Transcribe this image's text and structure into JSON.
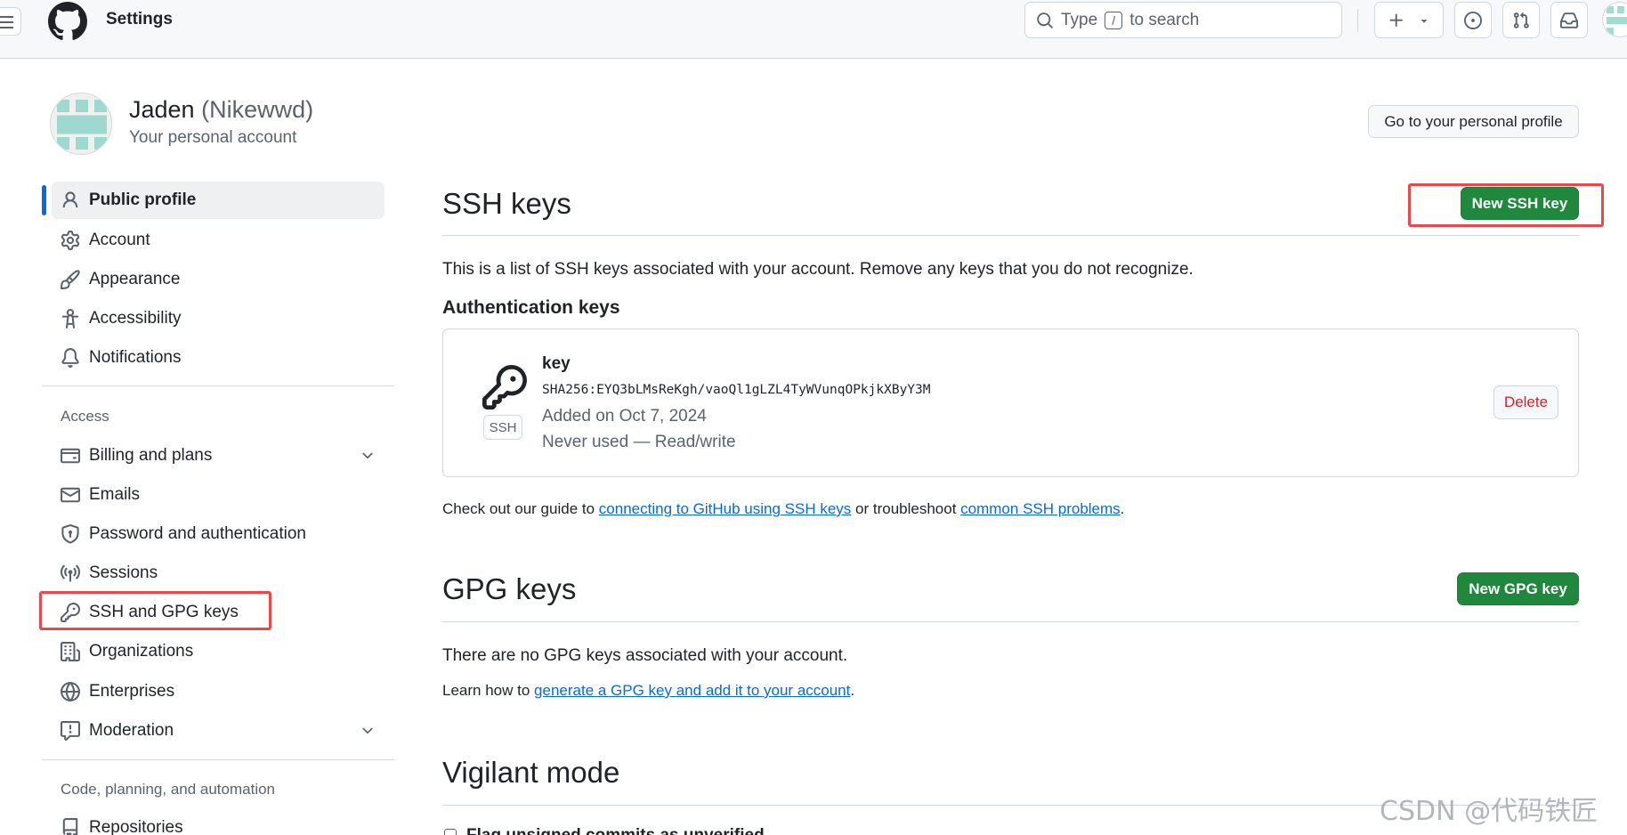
{
  "header": {
    "title": "Settings",
    "search_prefix": "Type",
    "search_key": "/",
    "search_suffix": "to search"
  },
  "profile": {
    "name": "Jaden",
    "login": "(Nikewwd)",
    "subtitle": "Your personal account",
    "go_profile_label": "Go to your personal profile"
  },
  "sidebar": {
    "items_top": [
      {
        "label": "Public profile",
        "icon": "person-icon",
        "active": true
      },
      {
        "label": "Account",
        "icon": "gear-icon"
      },
      {
        "label": "Appearance",
        "icon": "paintbrush-icon"
      },
      {
        "label": "Accessibility",
        "icon": "accessibility-icon"
      },
      {
        "label": "Notifications",
        "icon": "bell-icon"
      }
    ],
    "group_access": "Access",
    "items_access": [
      {
        "label": "Billing and plans",
        "icon": "credit-card-icon",
        "expandable": true
      },
      {
        "label": "Emails",
        "icon": "mail-icon"
      },
      {
        "label": "Password and authentication",
        "icon": "shield-lock-icon"
      },
      {
        "label": "Sessions",
        "icon": "broadcast-icon"
      },
      {
        "label": "SSH and GPG keys",
        "icon": "key-icon",
        "highlighted": true
      },
      {
        "label": "Organizations",
        "icon": "organization-icon"
      },
      {
        "label": "Enterprises",
        "icon": "globe-icon"
      },
      {
        "label": "Moderation",
        "icon": "report-icon",
        "expandable": true
      }
    ],
    "group_code": "Code, planning, and automation",
    "items_code": [
      {
        "label": "Repositories",
        "icon": "repo-icon"
      }
    ]
  },
  "ssh": {
    "title": "SSH keys",
    "new_button": "New SSH key",
    "description": "This is a list of SSH keys associated with your account. Remove any keys that you do not recognize.",
    "auth_title": "Authentication keys",
    "key": {
      "type_label": "SSH",
      "title": "key",
      "fingerprint": "SHA256:EYQ3bLMsReKgh/vaoQl1gLZL4TyWVunqOPkjkXByY3M",
      "added": "Added on Oct 7, 2024",
      "usage": "Never used — Read/write",
      "delete_label": "Delete"
    },
    "guide_prefix": "Check out our guide to",
    "guide_link1": "connecting to GitHub using SSH keys",
    "guide_middle": "or troubleshoot",
    "guide_link2": "common SSH problems",
    "guide_suffix": "."
  },
  "gpg": {
    "title": "GPG keys",
    "new_button": "New GPG key",
    "empty_text": "There are no GPG keys associated with your account.",
    "learn_prefix": "Learn how to",
    "learn_link": "generate a GPG key and add it to your account",
    "learn_suffix": "."
  },
  "vigilant": {
    "title": "Vigilant mode",
    "option_partial": "Flag unsigned commits as unverified"
  },
  "watermark": "CSDN @代码铁匠",
  "colors": {
    "primary_green": "#1f883d",
    "link_blue": "#0969da",
    "danger_red": "#d1242f",
    "highlight_red": "#e5484d"
  }
}
